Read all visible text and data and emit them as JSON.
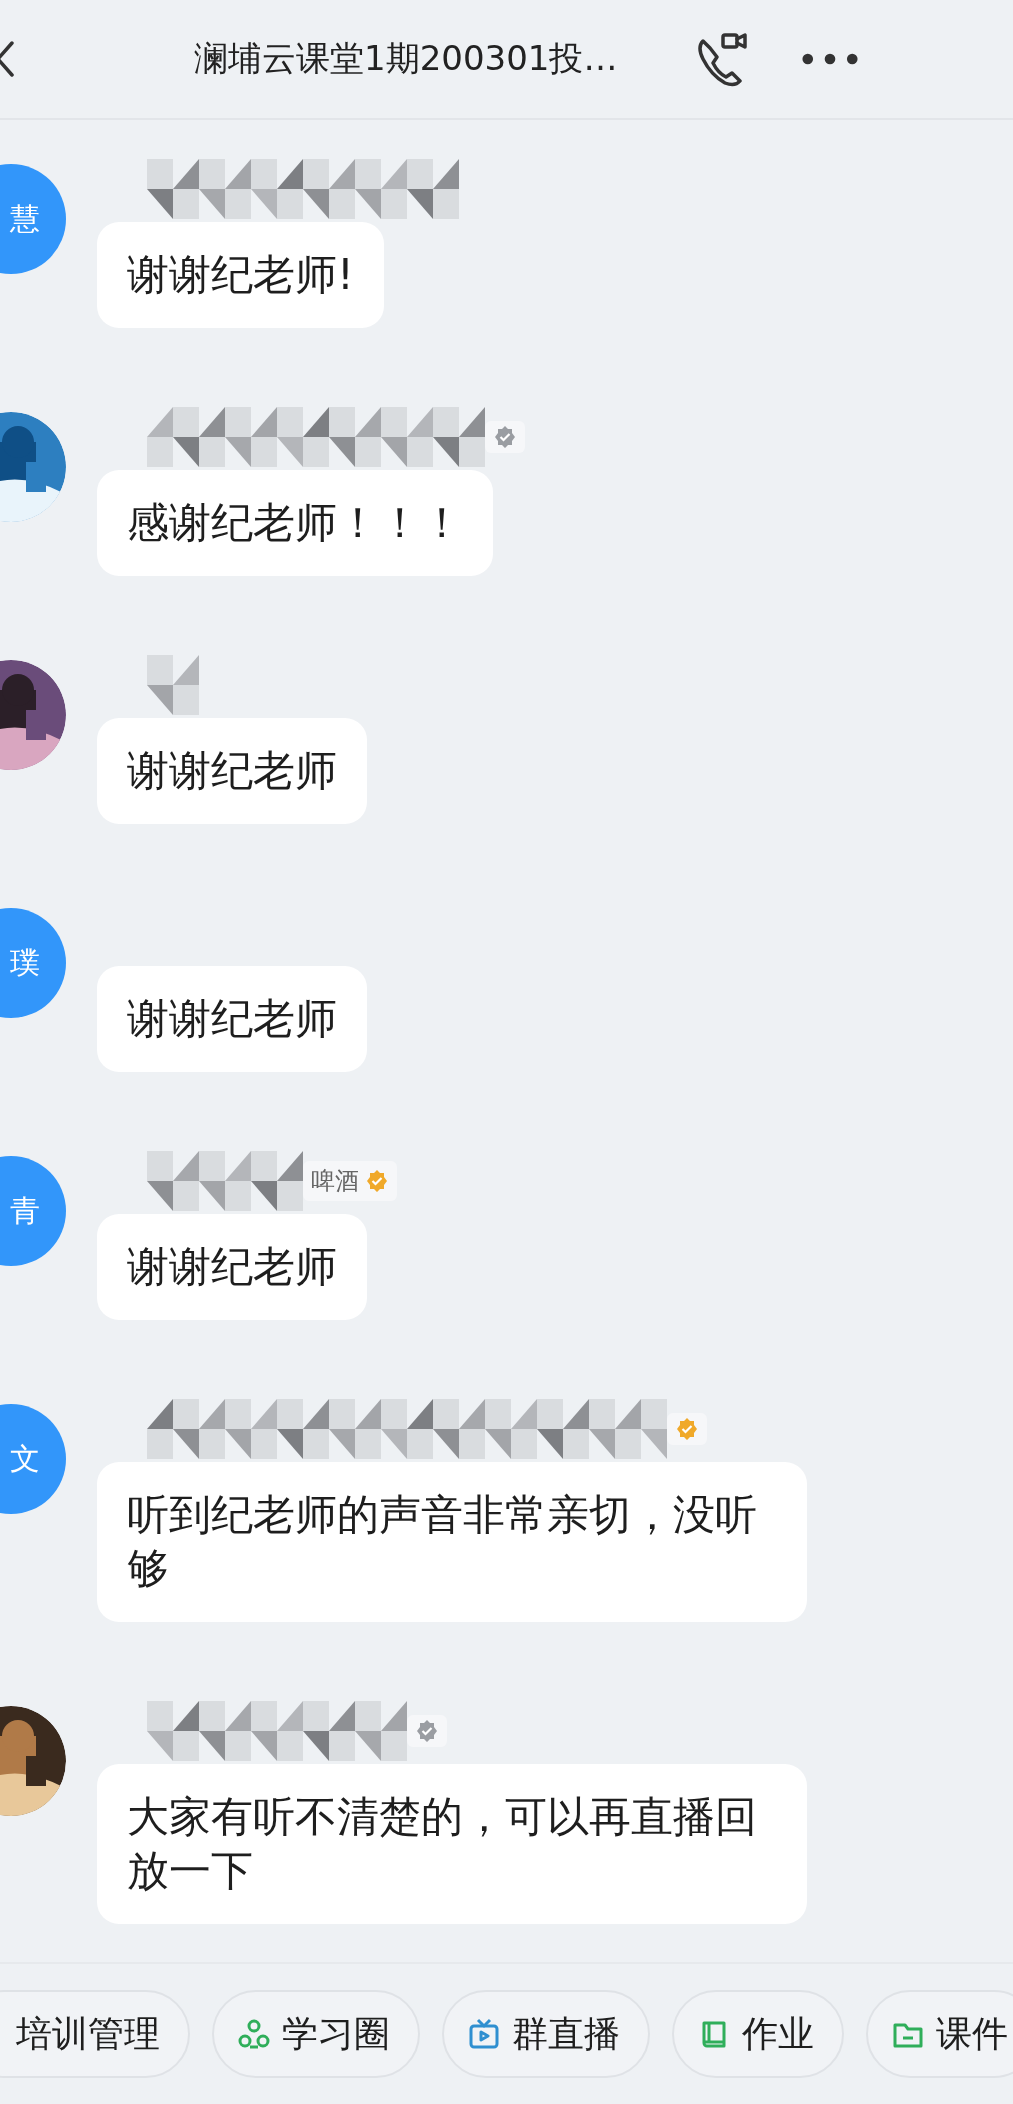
{
  "header": {
    "title": "澜埔云课堂1期200301投…"
  },
  "messages": [
    {
      "avatar": {
        "kind": "initials",
        "text": "慧"
      },
      "text": "谢谢纪老师!"
    },
    {
      "color": "#9a9da2",
      "text": "感谢纪老师！！！"
    },
    {
      "text": "谢谢纪老师"
    },
    {
      "avatar": {
        "kind": "initials",
        "text": "璞"
      },
      "text": "谢谢纪老师"
    },
    {
      "avatar": {
        "kind": "initials",
        "text": "青"
      },
      "name_visible": "啤酒",
      "color": "#f0a92a",
      "text": "谢谢纪老师"
    },
    {
      "avatar": {
        "kind": "initials",
        "text": "文"
      },
      "color": "#f0a92a",
      "text": "听到纪老师的声音非常亲切，没听够"
    },
    {
      "color": "#9a9da2",
      "text": "大家有听不清楚的，可以再直播回放一下"
    }
  ],
  "toolbar": [
    {
      "label": "培训管理"
    },
    {
      "label": "学习圈",
      "kind": "circles"
    },
    {
      "label": "群直播",
      "kind": "tv"
    },
    {
      "label": "作业",
      "kind": "book"
    },
    {
      "label": "课件",
      "kind": "folder"
    }
  ]
}
